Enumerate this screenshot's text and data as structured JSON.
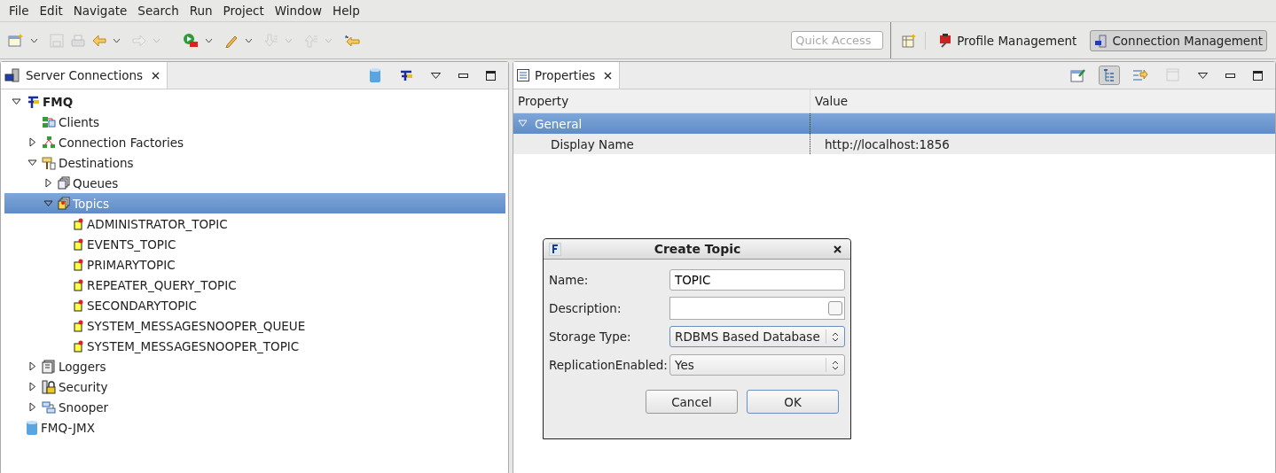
{
  "menu": [
    "File",
    "Edit",
    "Navigate",
    "Search",
    "Run",
    "Project",
    "Window",
    "Help"
  ],
  "quick_access": {
    "placeholder": "Quick Access"
  },
  "perspectives": [
    {
      "label": "Profile Management",
      "selected": false
    },
    {
      "label": "Connection Management",
      "selected": true
    }
  ],
  "left_view": {
    "title": "Server Connections",
    "tree": [
      {
        "label": "FMQ",
        "kind": "server",
        "bold": true,
        "expanded": true,
        "selected": false,
        "children": [
          {
            "label": "Clients",
            "kind": "clients",
            "bold": false,
            "selected": false
          },
          {
            "label": "Connection Factories",
            "kind": "factories",
            "bold": false,
            "expanded": false,
            "selected": false
          },
          {
            "label": "Destinations",
            "kind": "destinations",
            "bold": false,
            "expanded": true,
            "selected": false,
            "children": [
              {
                "label": "Queues",
                "kind": "queues",
                "bold": false,
                "expanded": false,
                "selected": false
              },
              {
                "label": "Topics",
                "kind": "topics",
                "bold": false,
                "expanded": true,
                "selected": true,
                "children": [
                  {
                    "label": "ADMINISTRATOR_TOPIC",
                    "kind": "topic",
                    "bold": false,
                    "selected": false
                  },
                  {
                    "label": "EVENTS_TOPIC",
                    "kind": "topic",
                    "bold": false,
                    "selected": false
                  },
                  {
                    "label": "PRIMARYTOPIC",
                    "kind": "topic",
                    "bold": false,
                    "selected": false
                  },
                  {
                    "label": "REPEATER_QUERY_TOPIC",
                    "kind": "topic",
                    "bold": false,
                    "selected": false
                  },
                  {
                    "label": "SECONDARYTOPIC",
                    "kind": "topic",
                    "bold": false,
                    "selected": false
                  },
                  {
                    "label": "SYSTEM_MESSAGESNOOPER_QUEUE",
                    "kind": "topic",
                    "bold": false,
                    "selected": false
                  },
                  {
                    "label": "SYSTEM_MESSAGESNOOPER_TOPIC",
                    "kind": "topic",
                    "bold": false,
                    "selected": false
                  }
                ]
              }
            ]
          },
          {
            "label": "Loggers",
            "kind": "loggers",
            "bold": false,
            "expanded": false,
            "selected": false
          },
          {
            "label": "Security",
            "kind": "security",
            "bold": false,
            "expanded": false,
            "selected": false
          },
          {
            "label": "Snooper",
            "kind": "snooper",
            "bold": false,
            "expanded": false,
            "selected": false
          }
        ]
      },
      {
        "label": "FMQ-JMX",
        "kind": "jmx",
        "bold": false,
        "selected": false
      }
    ]
  },
  "properties_view": {
    "title": "Properties",
    "columns": [
      "Property",
      "Value"
    ],
    "rows": [
      {
        "kind": "category",
        "property": "General",
        "expanded": true,
        "selected": true
      },
      {
        "kind": "property",
        "property": "Display Name",
        "value": "http://localhost:1856",
        "selected": false
      }
    ]
  },
  "dialog": {
    "title": "Create Topic",
    "fields": [
      {
        "kind": "text",
        "label": "Name:",
        "value": "TOPIC"
      },
      {
        "kind": "textarea",
        "label": "Description:"
      },
      {
        "kind": "select",
        "label": "Storage Type:",
        "value": "RDBMS Based Database",
        "focused": true
      },
      {
        "kind": "select",
        "label": "ReplicationEnabled:",
        "value": "Yes",
        "focused": false
      }
    ],
    "buttons": [
      {
        "label": "Cancel",
        "default": false
      },
      {
        "label": "OK",
        "default": true
      }
    ]
  }
}
